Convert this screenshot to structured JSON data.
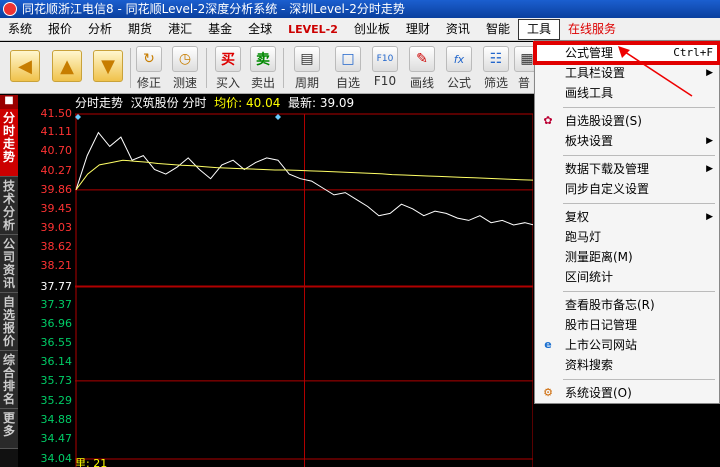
{
  "window": {
    "title": "同花顺浙江电信8 - 同花顺Level-2深度分析系统 - 深圳Level-2分时走势"
  },
  "menubar": [
    {
      "label": "系统"
    },
    {
      "label": "报价"
    },
    {
      "label": "分析"
    },
    {
      "label": "期货"
    },
    {
      "label": "港汇"
    },
    {
      "label": "基金"
    },
    {
      "label": "全球"
    },
    {
      "label": "LEVEL-2",
      "style": "red"
    },
    {
      "label": "创业板"
    },
    {
      "label": "理财"
    },
    {
      "label": "资讯"
    },
    {
      "label": "智能"
    },
    {
      "label": "工具",
      "style": "active"
    },
    {
      "label": "在线服务",
      "style": "online"
    }
  ],
  "toolbar": {
    "modify": "修正",
    "measure": "测速",
    "buy": "买入",
    "sell": "卖出",
    "period": "周期",
    "watchlist": "自选",
    "f10": "F10",
    "drawline": "画线",
    "formula": "公式",
    "screen": "筛选",
    "more": "普",
    "buy_glyph": "买",
    "sell_glyph": "卖",
    "f10_glyph": "F10"
  },
  "vtabs": [
    "分时走势",
    "技术分析",
    "公司资讯",
    "自选报价",
    "综合排名",
    "更多"
  ],
  "chart": {
    "header_title": "分时走势",
    "stock": "汉筑股份 分时",
    "avg_label": "均价: 40.04",
    "last_label": "最新: 39.09",
    "bottom_label": "里: 21"
  },
  "chart_data": {
    "type": "line",
    "title": "分时走势",
    "y_ticks": [
      41.5,
      41.11,
      40.7,
      40.27,
      39.86,
      39.45,
      39.03,
      38.62,
      38.21,
      37.77,
      37.37,
      36.96,
      36.55,
      36.14,
      35.73,
      35.29,
      34.88,
      34.47,
      34.04
    ],
    "y_tick_labels": [
      "41.50",
      "41.11",
      "40.70",
      "40.27",
      "39.86",
      "39.45",
      "39.03",
      "38.62",
      "38.21",
      "37.77",
      "37.37",
      "36.96",
      "36.55",
      "36.14",
      "35.73",
      "35.29",
      "34.88",
      "34.47",
      "34.04"
    ],
    "ylim": [
      34.04,
      41.5
    ],
    "prev_close": 37.77,
    "colors": {
      "up": "#ff3333",
      "prev_close": "#ffffff",
      "down": "#00cc66",
      "price_line": "#ffffff",
      "avg_line": "#ffff66",
      "grid": "#b00000"
    },
    "series": [
      {
        "name": "最新",
        "values": [
          39.86,
          40.6,
          41.1,
          40.8,
          41.0,
          40.5,
          40.6,
          40.3,
          40.2,
          40.35,
          40.55,
          40.3,
          40.1,
          40.4,
          40.5,
          40.3,
          40.45,
          40.55,
          40.5,
          40.2,
          40.1,
          40.05,
          39.9,
          39.75,
          39.8,
          39.65,
          39.5,
          39.3,
          39.35,
          39.55,
          39.45,
          39.3,
          39.4,
          39.35,
          39.25,
          39.2,
          39.3,
          39.15,
          39.2,
          39.1,
          39.15,
          39.09
        ]
      },
      {
        "name": "均价",
        "values": [
          39.86,
          40.2,
          40.4,
          40.45,
          40.5,
          40.48,
          40.46,
          40.43,
          40.41,
          40.39,
          40.38,
          40.36,
          40.34,
          40.33,
          40.32,
          40.31,
          40.3,
          40.29,
          40.29,
          40.28,
          40.27,
          40.26,
          40.25,
          40.24,
          40.23,
          40.22,
          40.21,
          40.19,
          40.18,
          40.17,
          40.16,
          40.15,
          40.14,
          40.13,
          40.12,
          40.11,
          40.1,
          40.09,
          40.08,
          40.07,
          40.06,
          40.04
        ]
      }
    ]
  },
  "dropdown": {
    "items": [
      {
        "label": "公式管理",
        "shortcut": "Ctrl+F",
        "highlight": true
      },
      {
        "label": "工具栏设置",
        "submenu": true
      },
      {
        "label": "画线工具"
      },
      {
        "label": "自选股设置(S)",
        "icon": "palette-icon"
      },
      {
        "label": "板块设置",
        "submenu": true
      },
      {
        "label": "数据下载及管理",
        "submenu": true
      },
      {
        "label": "同步自定义设置"
      },
      {
        "label": "复权",
        "submenu": true
      },
      {
        "label": "跑马灯"
      },
      {
        "label": "测量距离(M)"
      },
      {
        "label": "区间统计"
      },
      {
        "label": "查看股市备忘(R)"
      },
      {
        "label": "股市日记管理"
      },
      {
        "label": "上市公司网站",
        "icon": "ie-icon"
      },
      {
        "label": "资料搜索"
      },
      {
        "label": "系统设置(O)",
        "icon": "gear-icon"
      }
    ]
  }
}
